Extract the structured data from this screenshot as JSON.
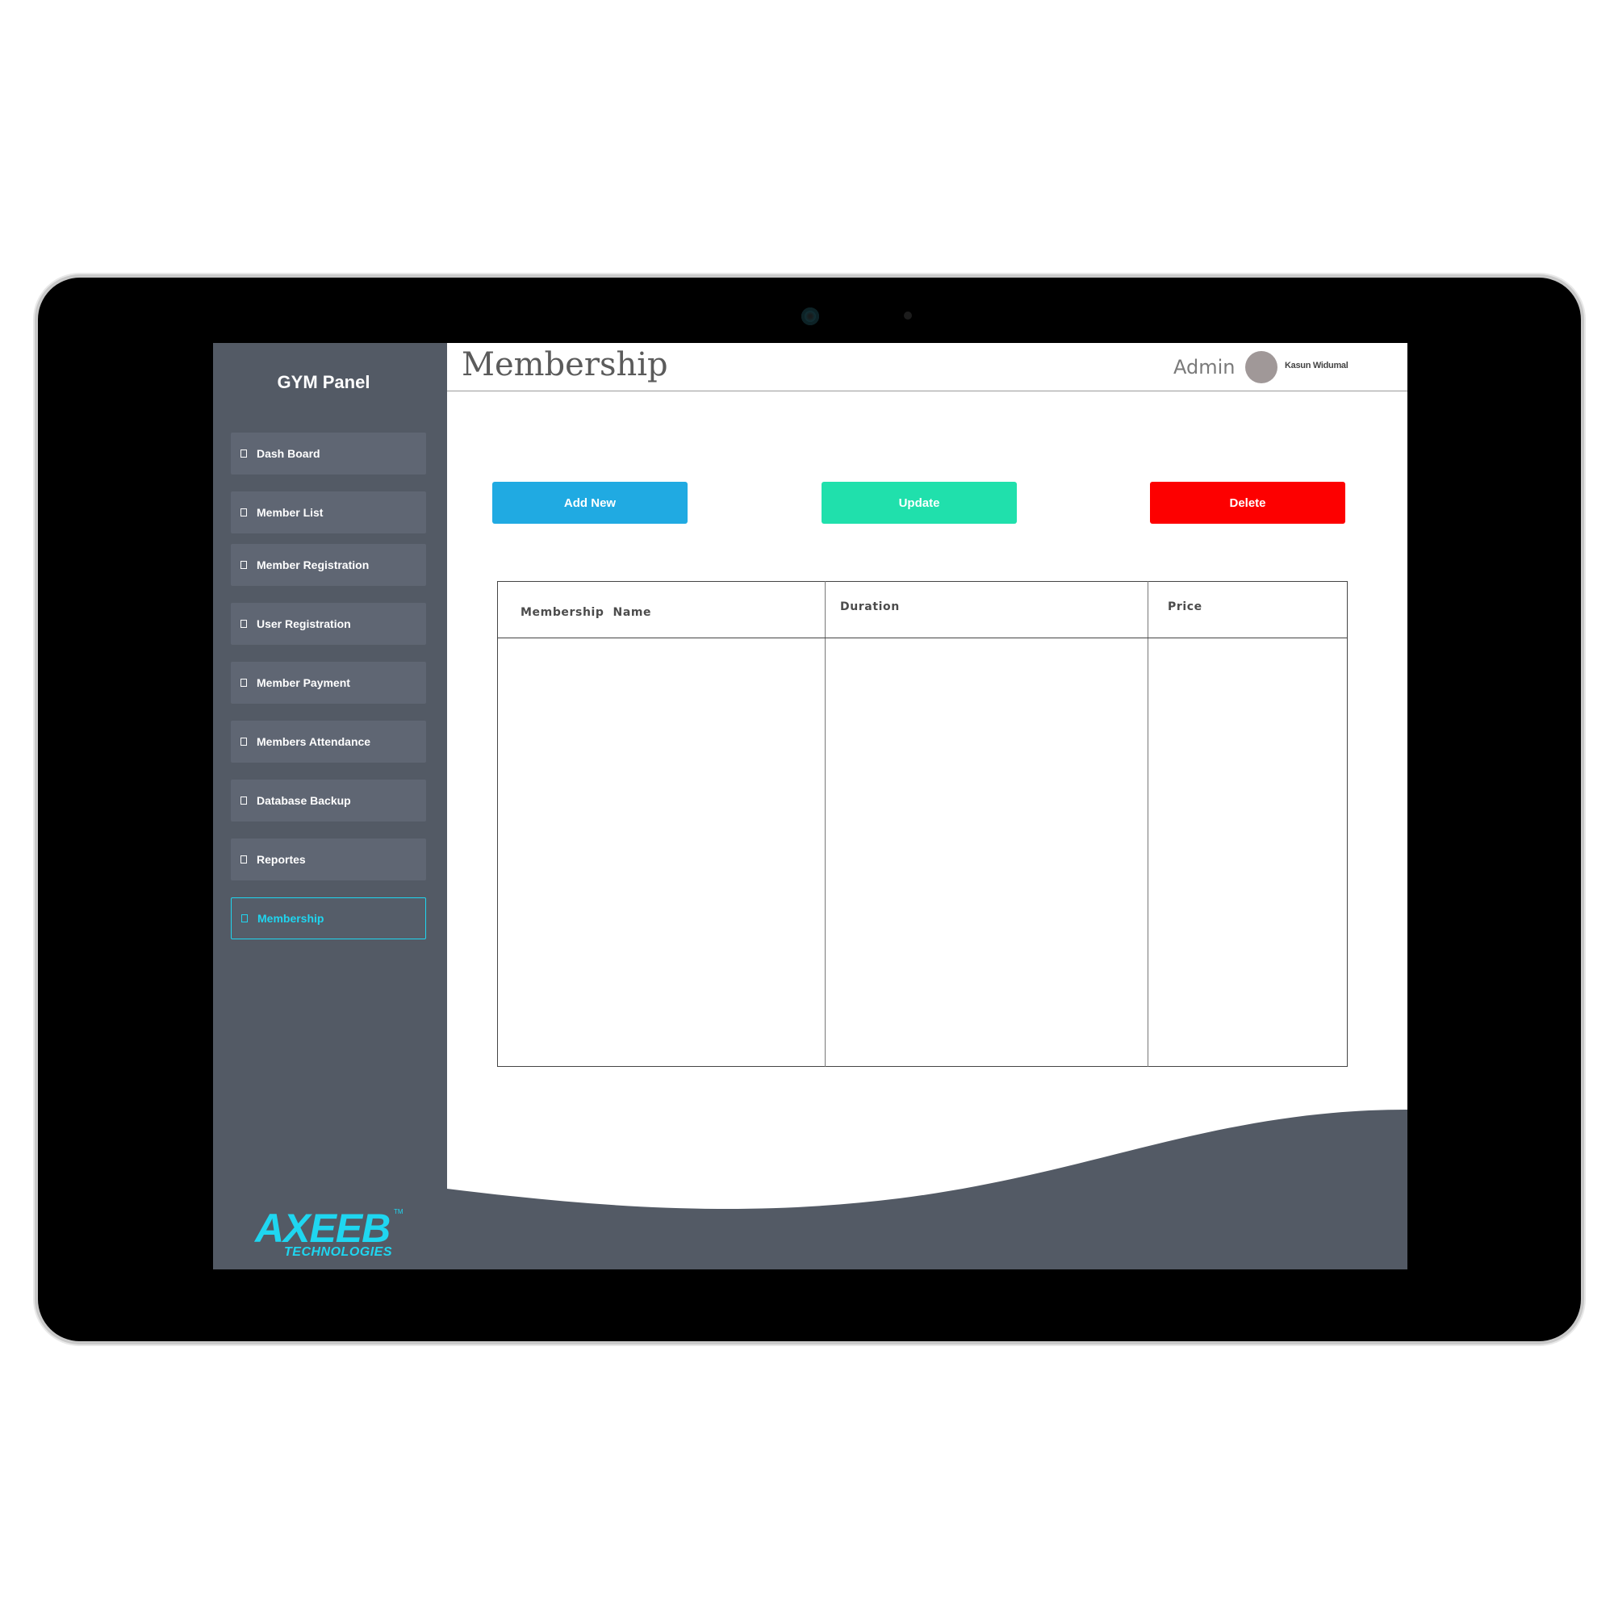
{
  "sidebar": {
    "brand": "GYM Panel",
    "items": [
      {
        "label": "Dash Board",
        "active": false
      },
      {
        "label": "Member List",
        "active": false
      },
      {
        "label": "Member Registration",
        "active": false
      },
      {
        "label": "User Registration",
        "active": false
      },
      {
        "label": "Member Payment",
        "active": false
      },
      {
        "label": "Members Attendance",
        "active": false
      },
      {
        "label": "Database Backup",
        "active": false
      },
      {
        "label": "Reportes",
        "active": false
      },
      {
        "label": "Membership",
        "active": true
      }
    ],
    "logo": {
      "main": "AXEEB",
      "sub": "TECHNOLOGIES",
      "tm": "TM"
    }
  },
  "header": {
    "title": "Membership",
    "role": "Admin",
    "user_name": "Kasun Widumal"
  },
  "actions": {
    "add_label": "Add New",
    "update_label": "Update",
    "delete_label": "Delete"
  },
  "table": {
    "columns": [
      "Membership  Name",
      "Duration",
      "Price"
    ],
    "rows": []
  },
  "colors": {
    "sidebar_bg": "#535a65",
    "accent": "#1fd6f0",
    "add_button": "#20aae2",
    "update_button": "#20e0ac",
    "delete_button": "#fd0000"
  }
}
